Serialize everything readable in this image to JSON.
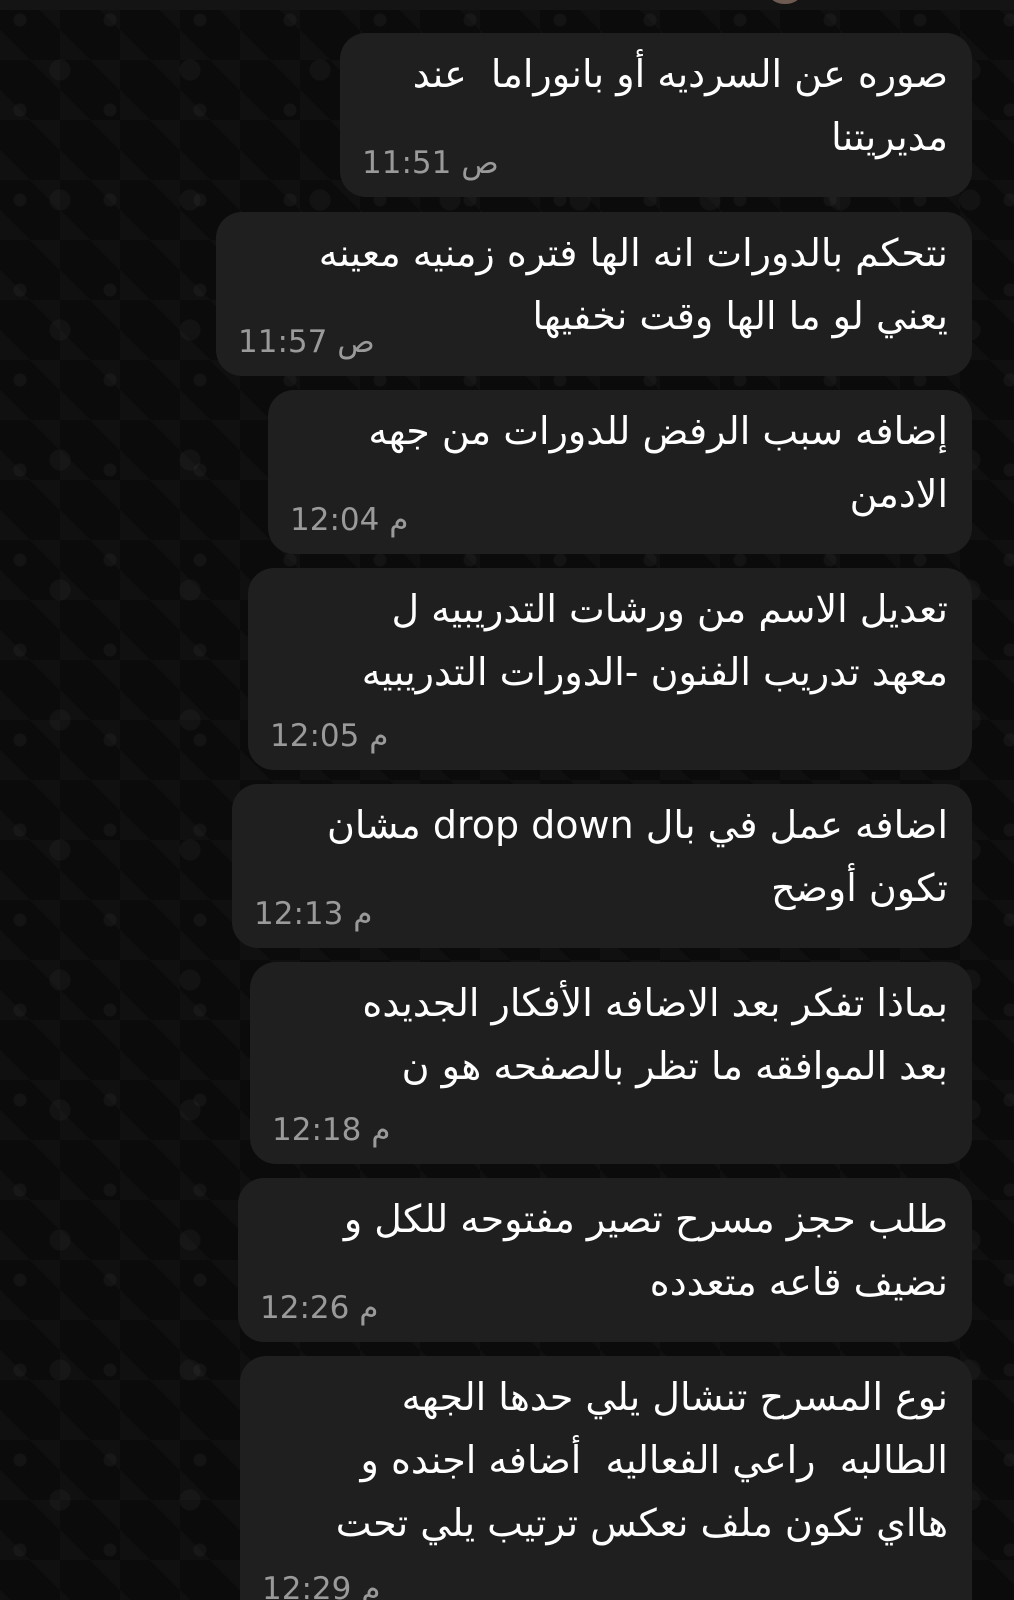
{
  "messages": [
    {
      "text": "صوره عن السرديه أو بانوراما  عند\nمديريتنا",
      "time": "11:51 ص"
    },
    {
      "text": "نتحكم بالدورات انه الها فتره زمنيه معينه\nيعني لو ما الها وقت نخفيها",
      "time": "11:57 ص"
    },
    {
      "text": "إضافه سبب الرفض للدورات من جهه\nالادمن",
      "time": "12:04 م"
    },
    {
      "text": "تعديل الاسم من ورشات التدريبيه ل\nمعهد تدريب الفنون -الدورات التدريبيه",
      "time": "12:05 م"
    },
    {
      "text": "اضافه عمل في بال drop down مشان\nتكون أوضح",
      "time": "12:13 م"
    },
    {
      "text": "بماذا تفكر بعد الاضافه الأفكار الجديده\nبعد الموافقه ما تظر بالصفحه هو ن",
      "time": "12:18 م"
    },
    {
      "text": "طلب حجز مسرح تصير مفتوحه للكل و\nنضيف قاعه متعدده",
      "time": "12:26 م"
    },
    {
      "text": "نوع المسرح تنشال يلي حدها الجهه\nالطالبه  راعي الفعاليه  أضافه اجنده و\nهااي تكون ملف نعكس ترتيب يلي تحت",
      "time": "12:29 م"
    }
  ]
}
